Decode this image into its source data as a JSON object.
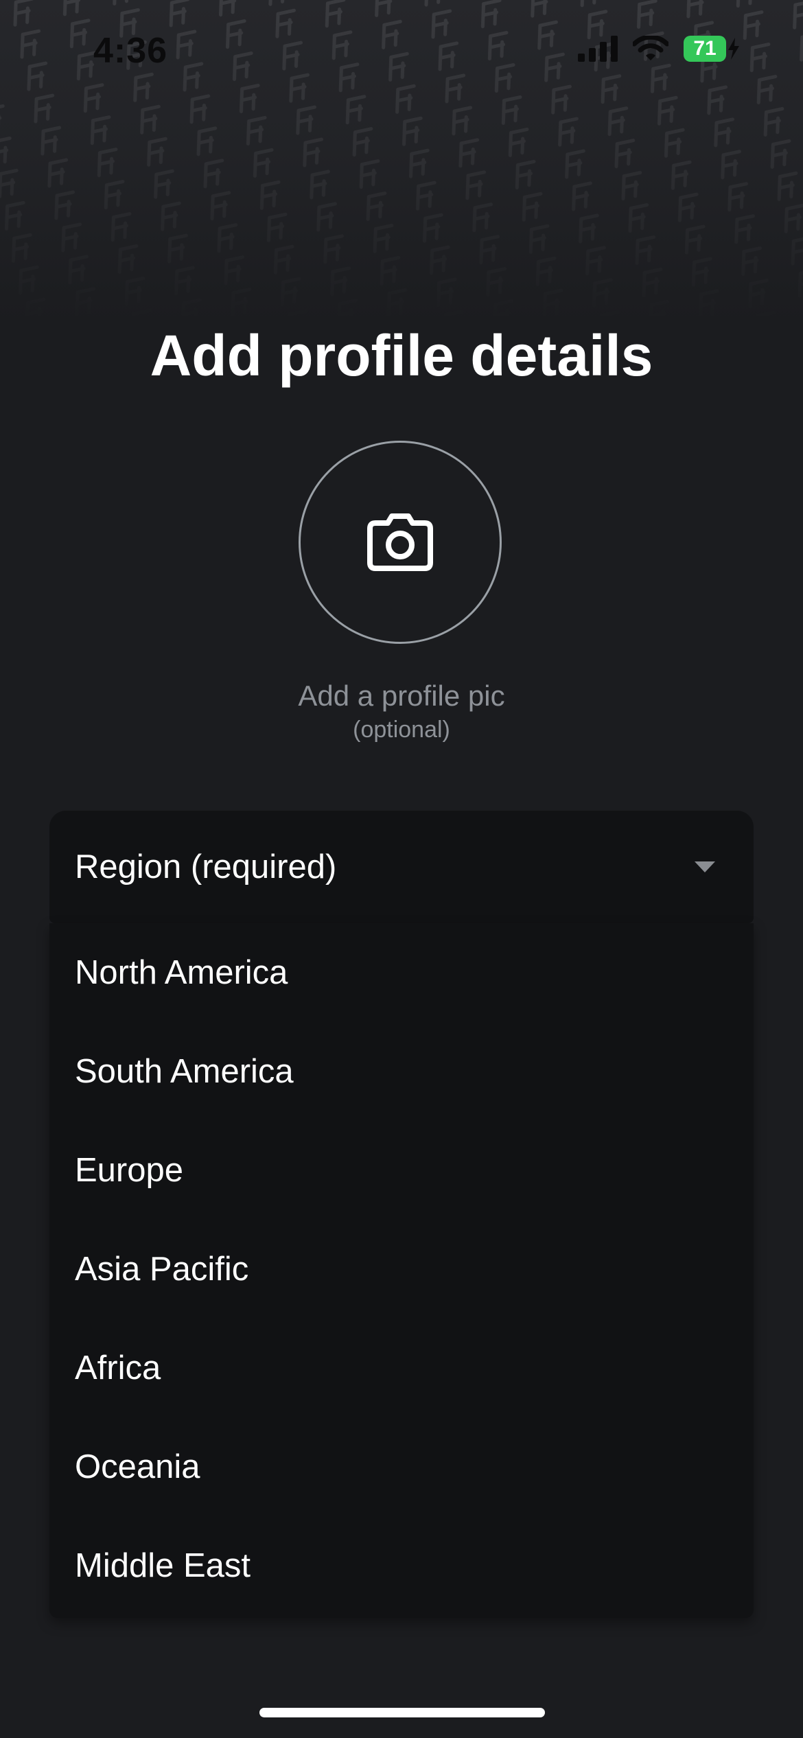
{
  "status_bar": {
    "time": "4:36",
    "battery_level": "71",
    "icons": [
      "cellular-signal-icon",
      "wifi-icon",
      "battery-charging-icon"
    ]
  },
  "background": {
    "pattern_icon": "brand-logo-pattern",
    "base_color": "#1b1c1f"
  },
  "page": {
    "title": "Add profile details"
  },
  "avatar": {
    "icon": "camera-icon",
    "caption": "Add a profile pic",
    "optional_label": "(optional)"
  },
  "region_select": {
    "label": "Region (required)",
    "icon": "dropdown-arrow-icon",
    "options": [
      "North America",
      "South America",
      "Europe",
      "Asia Pacific",
      "Africa",
      "Oceania",
      "Middle East"
    ]
  },
  "colors": {
    "text_primary": "#ffffff",
    "text_secondary": "#8e9298",
    "field_background": "#111214",
    "battery_green": "#34c759"
  }
}
